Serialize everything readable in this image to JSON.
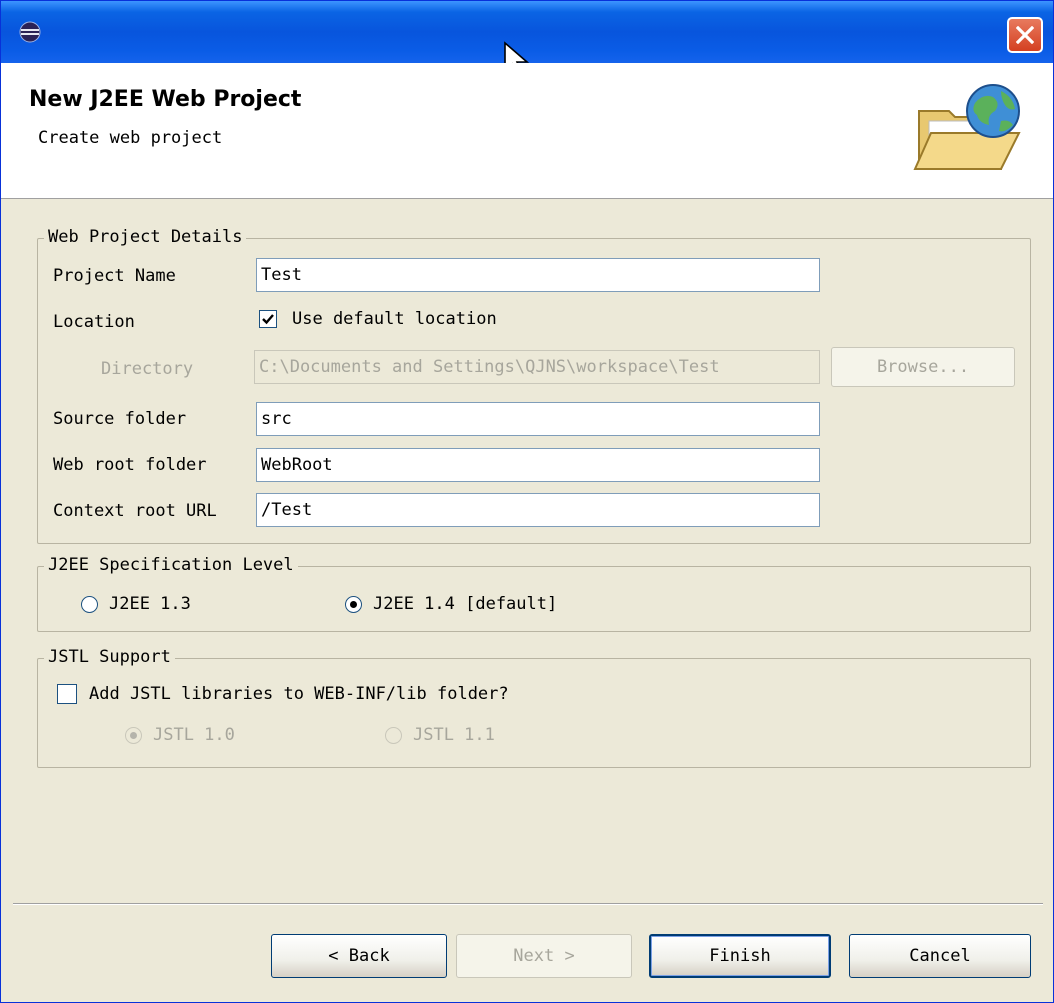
{
  "window": {
    "close_icon": "close-icon",
    "app_icon": "eclipse-icon"
  },
  "banner": {
    "title": "New J2EE Web Project",
    "subtitle": "Create web project",
    "icon": "folder-globe-icon"
  },
  "web_project_details": {
    "legend": "Web Project Details",
    "project_name_label": "Project Name",
    "project_name_value": "Test",
    "location_label": "Location",
    "use_default_location_label": "Use default location",
    "use_default_location_checked": true,
    "directory_label": "Directory",
    "directory_value": "C:\\Documents and Settings\\QJNS\\workspace\\Test",
    "browse_label": "Browse...",
    "source_folder_label": "Source folder",
    "source_folder_value": "src",
    "web_root_folder_label": "Web root folder",
    "web_root_folder_value": "WebRoot",
    "context_root_url_label": "Context root URL",
    "context_root_url_value": "/Test"
  },
  "j2ee_spec": {
    "legend": "J2EE Specification Level",
    "option_13": "J2EE 1.3",
    "option_14": "J2EE 1.4 [default]",
    "selected": "J2EE 1.4 [default]"
  },
  "jstl": {
    "legend": "JSTL Support",
    "add_jstl_label": "Add JSTL libraries to WEB-INF/lib folder?",
    "add_jstl_checked": false,
    "option_10": "JSTL 1.0",
    "option_11": "JSTL 1.1",
    "selected": "JSTL 1.0"
  },
  "buttons": {
    "back": "< Back",
    "next": "Next >",
    "finish": "Finish",
    "cancel": "Cancel"
  }
}
